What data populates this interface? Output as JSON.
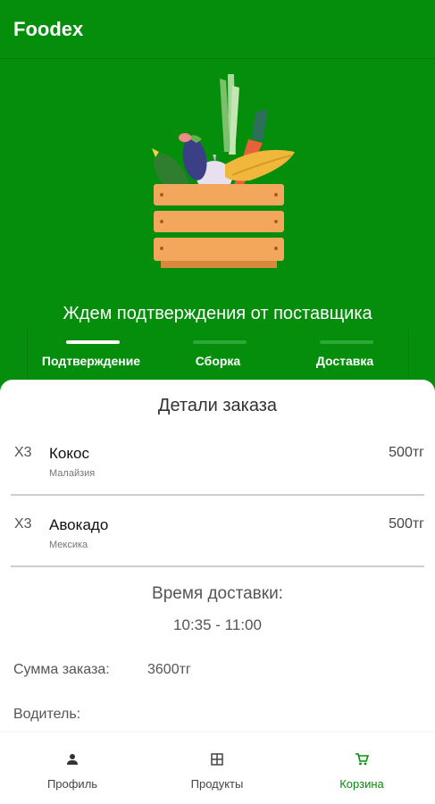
{
  "app": {
    "title": "Foodex"
  },
  "colors": {
    "brand_green": "#058d0c",
    "active_step": "#ffffff",
    "inactive_step": "#2ea83a"
  },
  "status": {
    "title": "Ждем подтверждения от поставщика"
  },
  "steps": [
    {
      "label": "Подтверждение",
      "active": true
    },
    {
      "label": "Сборка",
      "active": false
    },
    {
      "label": "Доставка",
      "active": false
    }
  ],
  "order": {
    "title": "Детали заказа",
    "items": [
      {
        "qty": "X3",
        "name": "Кокос",
        "origin": "Малайзия",
        "price": "500тг"
      },
      {
        "qty": "X3",
        "name": "Авокадо",
        "origin": "Мексика",
        "price": "500тг"
      }
    ],
    "delivery_time_label": "Время доставки:",
    "delivery_time_value": "10:35 - 11:00",
    "sum_label": "Сумма заказа:",
    "sum_value": "3600тг",
    "driver_label": "Водитель:"
  },
  "nav": [
    {
      "label": "Профиль",
      "icon": "person-icon",
      "active": false
    },
    {
      "label": "Продукты",
      "icon": "grid-icon",
      "active": false
    },
    {
      "label": "Корзина",
      "icon": "cart-icon",
      "active": true
    }
  ]
}
